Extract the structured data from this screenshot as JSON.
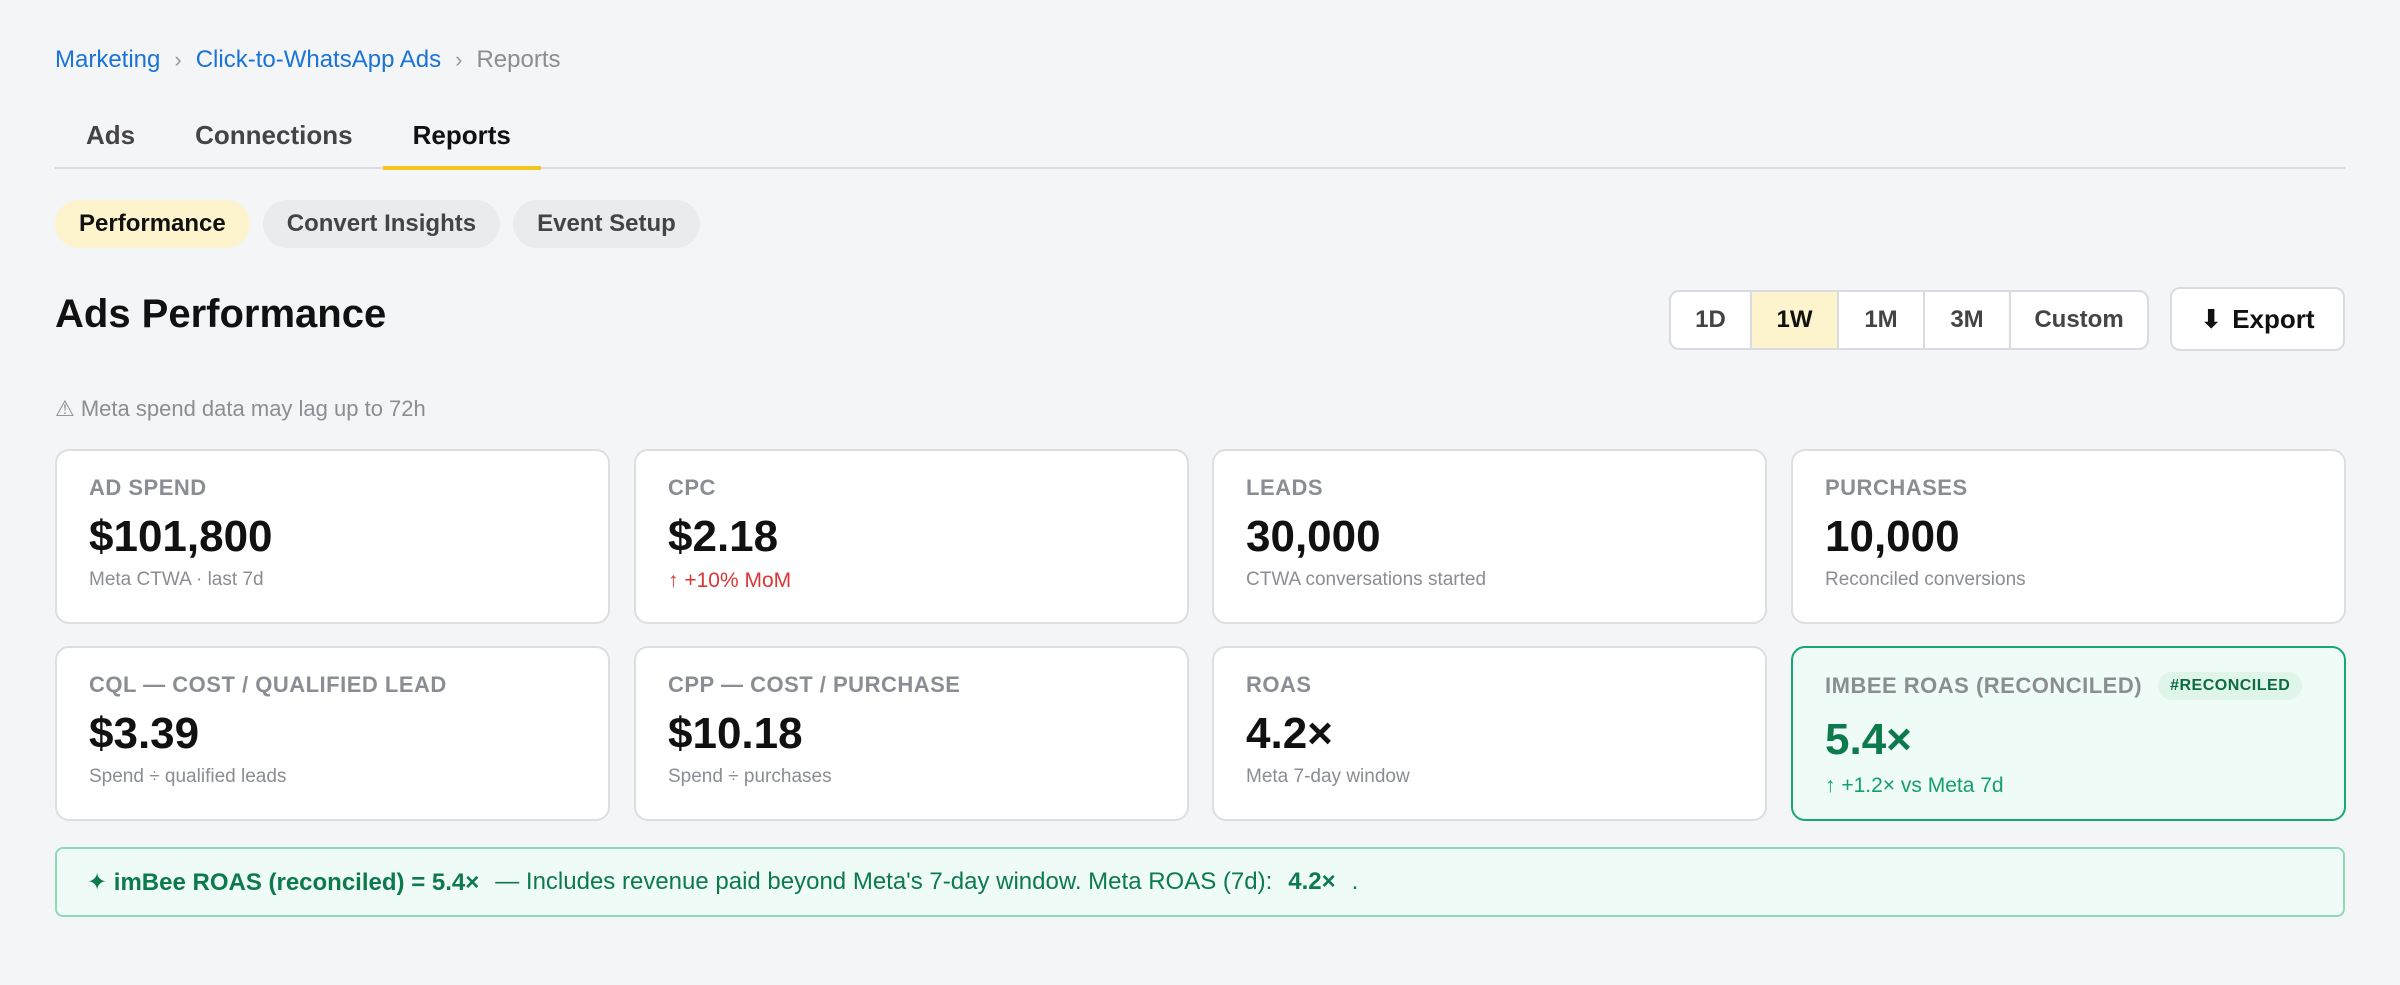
{
  "breadcrumb": {
    "items": [
      "Marketing",
      "Click-to-WhatsApp Ads"
    ],
    "current": "Reports",
    "separator": "›"
  },
  "tabs": [
    {
      "label": "Ads",
      "active": false
    },
    {
      "label": "Connections",
      "active": false
    },
    {
      "label": "Reports",
      "active": true
    }
  ],
  "subtabs": [
    {
      "label": "Performance",
      "active": true
    },
    {
      "label": "Convert Insights",
      "active": false
    },
    {
      "label": "Event Setup",
      "active": false
    }
  ],
  "page_title": "Ads Performance",
  "range": {
    "options": [
      "1D",
      "1W",
      "1M",
      "3M",
      "Custom"
    ],
    "selected": "1W"
  },
  "export": {
    "icon": "download-arrow-icon",
    "icon_glyph": "⬇",
    "label": "Export"
  },
  "notice": {
    "icon": "warning-icon",
    "icon_glyph": "⚠",
    "text": "Meta spend data may lag up to 72h"
  },
  "metrics": [
    {
      "label": "AD SPEND",
      "value": "$101,800",
      "sub": "Meta CTWA · last 7d"
    },
    {
      "label": "CPC",
      "value": "$2.18",
      "sub": "↑ +10% MoM",
      "sub_color": "#d93636"
    },
    {
      "label": "LEADS",
      "value": "30,000",
      "sub": "CTWA conversations started"
    },
    {
      "label": "PURCHASES",
      "value": "10,000",
      "sub": "Reconciled conversions"
    },
    {
      "label": "CQL — COST / QUALIFIED LEAD",
      "value": "$3.39",
      "sub": "Spend ÷ qualified leads"
    },
    {
      "label": "CPP — COST / PURCHASE",
      "value": "$10.18",
      "sub": "Spend ÷ purchases"
    },
    {
      "label": "ROAS",
      "value": "4.2×",
      "sub": "Meta 7-day window"
    },
    {
      "label": "IMBEE ROAS (RECONCILED)",
      "badge": "#RECONCILED",
      "value": "5.4×",
      "sub": "↑ +1.2× vs Meta 7d",
      "highlight": true
    }
  ],
  "banner": {
    "icon": "sparkle-icon",
    "lead": "✦ imBee ROAS (reconciled) = 5.4×",
    "text": "— Includes revenue paid beyond Meta's 7-day window. Meta ROAS (7d):",
    "value": "4.2×",
    "end": "."
  },
  "colors": {
    "accent_yellow": "#f3c623",
    "link_blue": "#1a73d6",
    "success_green": "#0c7a4d",
    "alert_red": "#d93636"
  }
}
